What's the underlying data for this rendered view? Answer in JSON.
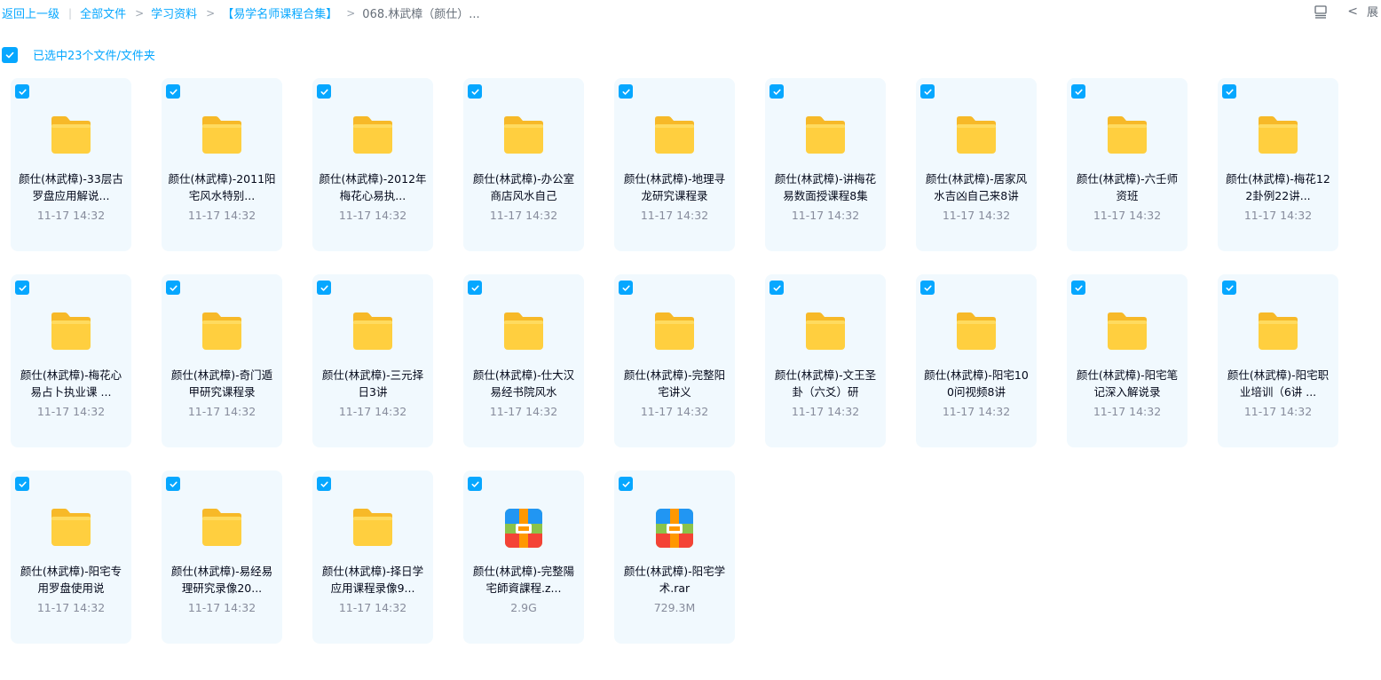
{
  "breadcrumb": {
    "back": "返回上一级",
    "all_files": "全部文件",
    "study": "学习资料",
    "collection": "【易学名师课程合集】",
    "current": "068.林武樟（颜仕）..."
  },
  "top_right": {
    "expand_label": "展"
  },
  "selection": {
    "label": "已选中23个文件/文件夹"
  },
  "colors": {
    "accent": "#06a7ff",
    "card_bg": "#f1f9fe",
    "folder": "#ffcf3f",
    "meta_text": "#878c9c"
  },
  "files": [
    {
      "name": "颜仕(林武樟)-33层古罗盘应用解说...",
      "meta": "11-17 14:32",
      "icon": "folder-icon"
    },
    {
      "name": "颜仕(林武樟)-2011阳宅风水特别...",
      "meta": "11-17 14:32",
      "icon": "folder-icon"
    },
    {
      "name": "颜仕(林武樟)-2012年梅花心易执...",
      "meta": "11-17 14:32",
      "icon": "folder-icon"
    },
    {
      "name": "颜仕(林武樟)-办公室商店风水自己",
      "meta": "11-17 14:32",
      "icon": "folder-icon"
    },
    {
      "name": "颜仕(林武樟)-地理寻龙研究课程录",
      "meta": "11-17 14:32",
      "icon": "folder-icon"
    },
    {
      "name": "颜仕(林武樟)-讲梅花易数面授课程8集",
      "meta": "11-17 14:32",
      "icon": "folder-icon"
    },
    {
      "name": "颜仕(林武樟)-居家风水吉凶自己来8讲",
      "meta": "11-17 14:32",
      "icon": "folder-icon"
    },
    {
      "name": "颜仕(林武樟)-六壬师资班",
      "meta": "11-17 14:32",
      "icon": "folder-icon"
    },
    {
      "name": "颜仕(林武樟)-梅花122卦例22讲...",
      "meta": "11-17 14:32",
      "icon": "folder-icon"
    },
    {
      "name": "颜仕(林武樟)-梅花心易占卜执业课 ...",
      "meta": "11-17 14:32",
      "icon": "folder-icon"
    },
    {
      "name": "颜仕(林武樟)-奇门遁甲研究课程录",
      "meta": "11-17 14:32",
      "icon": "folder-icon"
    },
    {
      "name": "颜仕(林武樟)-三元择日3讲",
      "meta": "11-17 14:32",
      "icon": "folder-icon"
    },
    {
      "name": "颜仕(林武樟)-仕大汉易经书院风水",
      "meta": "11-17 14:32",
      "icon": "folder-icon"
    },
    {
      "name": "颜仕(林武樟)-完整阳宅讲义",
      "meta": "11-17 14:32",
      "icon": "folder-icon"
    },
    {
      "name": "颜仕(林武樟)-文王圣卦（六爻）研",
      "meta": "11-17 14:32",
      "icon": "folder-icon"
    },
    {
      "name": "颜仕(林武樟)-阳宅100问视频8讲",
      "meta": "11-17 14:32",
      "icon": "folder-icon"
    },
    {
      "name": "颜仕(林武樟)-阳宅笔记深入解说录",
      "meta": "11-17 14:32",
      "icon": "folder-icon"
    },
    {
      "name": "颜仕(林武樟)-阳宅职业培训（6讲 ...",
      "meta": "11-17 14:32",
      "icon": "folder-icon"
    },
    {
      "name": "颜仕(林武樟)-阳宅专用罗盘使用说",
      "meta": "11-17 14:32",
      "icon": "folder-icon"
    },
    {
      "name": "颜仕(林武樟)-易经易理研究录像20...",
      "meta": "11-17 14:32",
      "icon": "folder-icon"
    },
    {
      "name": "颜仕(林武樟)-择日学应用课程录像9...",
      "meta": "11-17 14:32",
      "icon": "folder-icon"
    },
    {
      "name": "颜仕(林武樟)-完整陽宅師資課程.z...",
      "meta": "2.9G",
      "icon": "archive-icon"
    },
    {
      "name": "颜仕(林武樟)-阳宅学术.rar",
      "meta": "729.3M",
      "icon": "archive-icon"
    }
  ]
}
